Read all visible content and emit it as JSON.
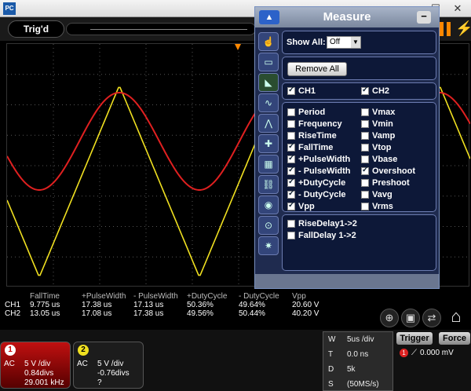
{
  "window": {
    "app_icon": "PC",
    "minimize": "—",
    "maximize": "☐",
    "close": "✕"
  },
  "status": {
    "trigger_state": "Trig'd"
  },
  "measure_dialog": {
    "title": "Measure",
    "show_all_label": "Show All:",
    "show_all_value": "Off",
    "remove_all": "Remove All",
    "channels": [
      {
        "label": "CH1",
        "checked": true
      },
      {
        "label": "CH2",
        "checked": true
      }
    ],
    "items": [
      {
        "label": "Period",
        "checked": false
      },
      {
        "label": "Vmax",
        "checked": false
      },
      {
        "label": "Frequency",
        "checked": false
      },
      {
        "label": "Vmin",
        "checked": false
      },
      {
        "label": "RiseTime",
        "checked": false
      },
      {
        "label": "Vamp",
        "checked": false
      },
      {
        "label": "FallTime",
        "checked": true
      },
      {
        "label": "Vtop",
        "checked": false
      },
      {
        "label": "+PulseWidth",
        "checked": true
      },
      {
        "label": "Vbase",
        "checked": false
      },
      {
        "label": "- PulseWidth",
        "checked": true
      },
      {
        "label": "Overshoot",
        "checked": true
      },
      {
        "label": "+DutyCycle",
        "checked": true
      },
      {
        "label": "Preshoot",
        "checked": false
      },
      {
        "label": "- DutyCycle",
        "checked": true
      },
      {
        "label": "Vavg",
        "checked": false
      },
      {
        "label": "Vpp",
        "checked": true
      },
      {
        "label": "Vrms",
        "checked": false
      }
    ],
    "delays": [
      {
        "label": "RiseDelay1->2",
        "checked": false
      },
      {
        "label": "FallDelay 1->2",
        "checked": false
      }
    ]
  },
  "measurements": {
    "headers": [
      "FallTime",
      "+PulseWidth",
      "- PulseWidth",
      "+DutyCycle",
      "- DutyCycle",
      "Vpp"
    ],
    "rows": [
      {
        "channel": "CH1",
        "values": [
          "9.775 us",
          "17.38 us",
          "17.13 us",
          "50.36%",
          "49.64%",
          "20.60 V"
        ]
      },
      {
        "channel": "CH2",
        "values": [
          "13.05 us",
          "17.08 us",
          "17.38 us",
          "49.56%",
          "50.44%",
          "40.20 V"
        ]
      }
    ]
  },
  "ch1": {
    "badge": "1",
    "coupling": "AC",
    "vdiv": "5 V /div",
    "offset": "0.84divs",
    "freq": "29.001 kHz",
    "color": "#e02020"
  },
  "ch2": {
    "badge": "2",
    "coupling": "AC",
    "vdiv": "5 V /div",
    "offset": "-0.76divs",
    "freq": "?",
    "color": "#f0e020"
  },
  "timebase": {
    "rows": [
      {
        "key": "W",
        "value": "5us /div"
      },
      {
        "key": "T",
        "value": "0.0 ns"
      },
      {
        "key": "D",
        "value": "5k"
      },
      {
        "key": "S",
        "value": "(50MS/s)"
      }
    ]
  },
  "trigger": {
    "trigger_label": "Trigger",
    "force_label": "Force",
    "channel": "1",
    "edge_icon": "rising-edge-icon",
    "level": "0.000 mV"
  },
  "icons": [
    "hand-icon",
    "channel-icon",
    "measure-icon",
    "math-icon",
    "fft-icon",
    "cursor-icon",
    "reference-icon",
    "chain-icon",
    "autoset-icon",
    "zoom-icon",
    "settings-icon"
  ]
}
